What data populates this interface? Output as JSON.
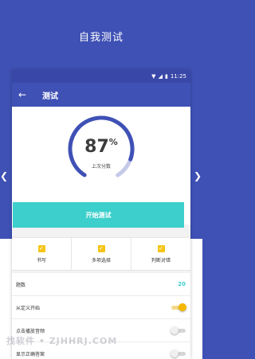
{
  "headline": "自我测试",
  "status_bar": {
    "time": "11:25"
  },
  "app_bar": {
    "title": "测试"
  },
  "score": {
    "value": "87",
    "unit": "%",
    "label": "上次分数",
    "fraction": 0.87
  },
  "start_button": {
    "label": "开始测试"
  },
  "modes": [
    {
      "label": "书写",
      "checked": true
    },
    {
      "label": "多项选择",
      "checked": true
    },
    {
      "label": "判断对错",
      "checked": true
    }
  ],
  "settings": {
    "count": {
      "label": "题数",
      "value": "20"
    },
    "custom_start": {
      "label": "从定义开始",
      "on": true
    },
    "play_audio": {
      "label": "点击播放音频",
      "on": false
    },
    "show_answer": {
      "label": "显示正确答案",
      "on": false
    }
  },
  "watermark": "找软件 • ZJHHRJ.COM",
  "colors": {
    "primary": "#3f51b5",
    "accent": "#3ccfcb",
    "toggle_on": "#f5b800",
    "checkbox": "#f5c518"
  }
}
